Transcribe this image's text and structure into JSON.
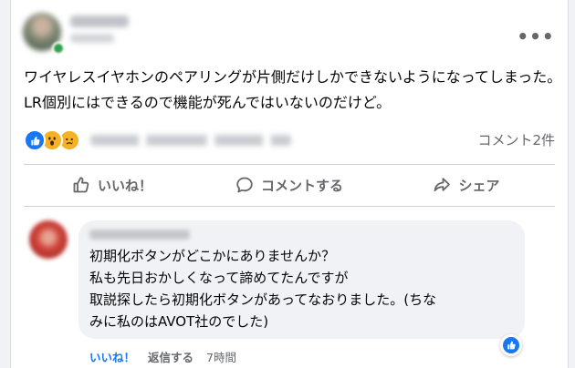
{
  "post": {
    "more_label": "•••",
    "text": "ワイヤレスイヤホンのペアリングが片側だけしかできないようになってしまった。LR個別にはできるので機能が死んではいないのだけど。",
    "reactions": [
      "like",
      "wow",
      "sad"
    ],
    "comment_count": "コメント2件"
  },
  "actions": {
    "like_label": "いいね！",
    "comment_label": "コメントする",
    "share_label": "シェア"
  },
  "comment": {
    "lines": [
      "初期化ボタンがどこかにありませんか？",
      "私も先日おかしくなって諦めてたんですが",
      "取説探したら初期化ボタンがあってなおりました。(ちな",
      "みに私のはAVOT社のでした)"
    ],
    "like_label": "いいね！",
    "reply_label": "返信する",
    "time": "7時間"
  },
  "colors": {
    "accent": "#1877f2",
    "secondary_text": "#65676b",
    "bubble": "#f0f2f5",
    "divider": "#ced0d4",
    "online": "#31a24c"
  },
  "icons": {
    "like": "thumbs-up-icon",
    "comment": "speech-bubble-icon",
    "share": "share-arrow-icon",
    "more": "more-dots-icon"
  }
}
